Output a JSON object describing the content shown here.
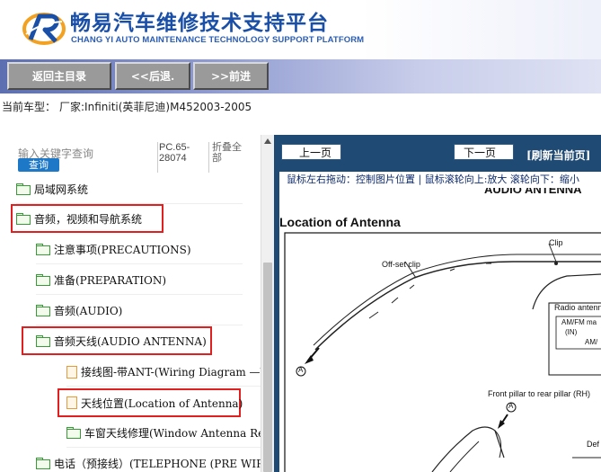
{
  "header": {
    "title_cn": "畅易汽车维修技术支持平台",
    "title_en": "CHANG YI AUTO MAINTENANCE TECHNOLOGY SUPPORT PLATFORM"
  },
  "toolbar": {
    "home_label": "返回主目录",
    "back_label": "<<后退.",
    "forward_label": ">>前进"
  },
  "model": {
    "label": "当前车型：",
    "value": "厂家:Infiniti(英菲尼迪)M452003-2005"
  },
  "left_panel": {
    "search_placeholder": "输入关键字查询",
    "search_button": "查询",
    "pc_info": "PC.65-28074",
    "fold_all": "折叠全部",
    "tree": [
      {
        "label": "局域网系统",
        "icon": "folder-icon"
      },
      {
        "label": "音频，视频和导航系统",
        "icon": "folder-icon",
        "highlighted": true
      },
      {
        "label": "注意事项(PRECAUTIONS)",
        "icon": "folder-icon"
      },
      {
        "label": "准备(PREPARATION)",
        "icon": "folder-icon"
      },
      {
        "label": "音频(AUDIO)",
        "icon": "folder-icon"
      },
      {
        "label": "音频天线(AUDIO ANTENNA)",
        "icon": "folder-icon",
        "highlighted": true
      },
      {
        "label": "接线图-带ANT-(Wiring Diagram —W",
        "icon": "page-icon"
      },
      {
        "label": "天线位置(Location of Antenna)",
        "icon": "page-icon",
        "highlighted": true
      },
      {
        "label": "车窗天线修理(Window Antenna Rep",
        "icon": "folder-icon"
      },
      {
        "label": "电话（预接线）(TELEPHONE (PRE WIR",
        "icon": "folder-icon"
      }
    ]
  },
  "viewer": {
    "prev_page": "上一页",
    "next_page": "下一页",
    "refresh": "[刷新当前页]",
    "hint": "鼠标左右拖动：控制图片位置 | 鼠标滚轮向上:放大  滚轮向下：缩小",
    "doc_header": "AUDIO ANTENNA",
    "doc_title": "Location of Antenna",
    "labels": {
      "clip": "Clip",
      "offset_clip": "Off-set clip",
      "radio_antenna": "Radio antenna",
      "amfm_ma": "AM/FM ma",
      "in": "(IN)",
      "am": "AM/",
      "marker_a": "A",
      "front_pillar": "Front pillar to rear pillar (RH)",
      "def": "Def"
    }
  },
  "colors": {
    "brand_blue": "#1a4fa8",
    "highlight_red": "#e02020",
    "viewer_bg": "#1f4a73",
    "search_button_bg": "#1e78c8"
  }
}
